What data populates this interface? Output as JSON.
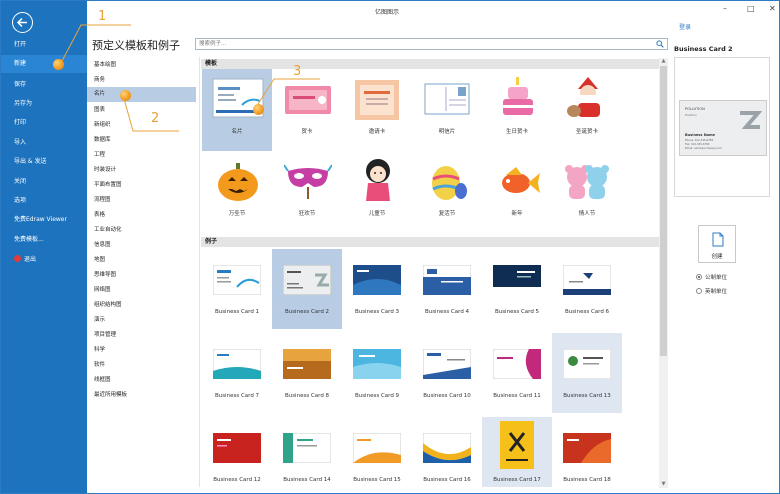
{
  "window": {
    "title": "亿图图示",
    "minimize": "–",
    "maximize": "□",
    "close": "✕",
    "login": "登录"
  },
  "sidebar": {
    "items": [
      {
        "label": "打开"
      },
      {
        "label": "新建"
      },
      {
        "label": "保存"
      },
      {
        "label": "另存为"
      },
      {
        "label": "打印"
      },
      {
        "label": "导入"
      },
      {
        "label": "导出 & 发送"
      },
      {
        "label": "关闭"
      },
      {
        "label": "选项"
      },
      {
        "label": "免费Edraw Viewer"
      },
      {
        "label": "免费模板..."
      },
      {
        "label": "退出"
      }
    ],
    "active_index": 1
  },
  "header": {
    "heading": "预定义模板和例子",
    "search_placeholder": "搜索例子..."
  },
  "categories": {
    "items": [
      "基本绘图",
      "商务",
      "名片",
      "图表",
      "新组织",
      "数据库",
      "工程",
      "时装设计",
      "平面布置图",
      "流程图",
      "表格",
      "工业自动化",
      "信息图",
      "地图",
      "思维导图",
      "网络图",
      "组织结构图",
      "演示",
      "项目管理",
      "科学",
      "软件",
      "线框图",
      "最近所用模板"
    ],
    "active_index": 2
  },
  "gallery": {
    "templates_header": "模板",
    "examples_header": "例子",
    "templates": [
      {
        "label": "名片",
        "icon": "business-card-icon"
      },
      {
        "label": "贺卡",
        "icon": "greeting-card-icon"
      },
      {
        "label": "邀请卡",
        "icon": "invitation-card-icon"
      },
      {
        "label": "明信片",
        "icon": "postcard-icon"
      },
      {
        "label": "生日贺卡",
        "icon": "birthday-cake-icon"
      },
      {
        "label": "圣诞贺卡",
        "icon": "santa-claus-icon"
      },
      {
        "label": "万圣节",
        "icon": "pumpkin-icon"
      },
      {
        "label": "狂欢节",
        "icon": "carnival-mask-icon"
      },
      {
        "label": "儿童节",
        "icon": "doll-icon"
      },
      {
        "label": "复活节",
        "icon": "easter-egg-icon"
      },
      {
        "label": "新年",
        "icon": "goldfish-icon"
      },
      {
        "label": "情人节",
        "icon": "teddy-bears-icon"
      }
    ],
    "examples": [
      {
        "label": "Business Card 1"
      },
      {
        "label": "Business Card 2"
      },
      {
        "label": "Business Card 3"
      },
      {
        "label": "Business Card 4"
      },
      {
        "label": "Business Card 5"
      },
      {
        "label": "Business Card 6"
      },
      {
        "label": "Business Card 7"
      },
      {
        "label": "Business Card 8"
      },
      {
        "label": "Business Card 9"
      },
      {
        "label": "Business Card 10"
      },
      {
        "label": "Business Card 11"
      },
      {
        "label": "Business Card 13"
      },
      {
        "label": "Business Card 12"
      },
      {
        "label": "Business Card 14"
      },
      {
        "label": "Business Card 15"
      },
      {
        "label": "Business Card 16"
      },
      {
        "label": "Business Card 17"
      },
      {
        "label": "Business Card 18"
      }
    ]
  },
  "preview": {
    "title": "Business Card 2",
    "card_text_top": "POLLUTION",
    "card_text_sub": "Position",
    "card_name": "Business Name",
    "card_lines": [
      "Phone: 012-345-6789",
      "Fax: 012-345-6789",
      "Email: name@company.com"
    ],
    "create_label": "创建",
    "units": [
      {
        "label": "公制单位",
        "checked": true
      },
      {
        "label": "英制单位",
        "checked": false
      }
    ]
  },
  "callouts": [
    "1",
    "2",
    "3"
  ],
  "colors": {
    "sidebar": "#1e73be",
    "selected": "#b8cde4",
    "accent": "#2b7cc5",
    "callout": "#e9a23b"
  }
}
